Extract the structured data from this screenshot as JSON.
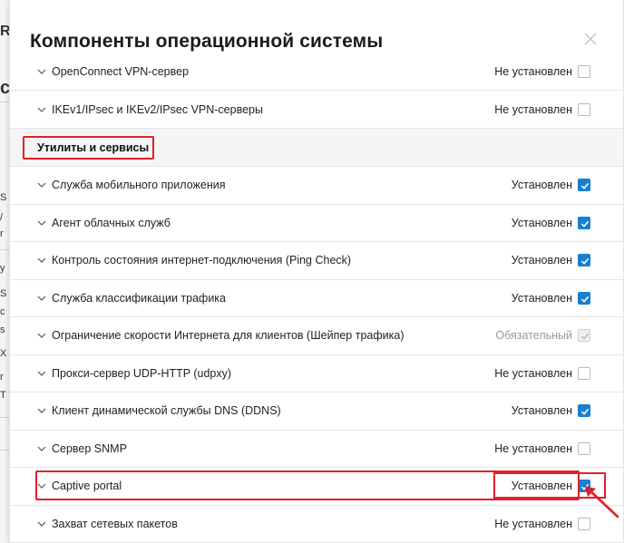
{
  "background": {
    "fragments": [
      "R",
      "c",
      "S",
      "/",
      "r",
      "y",
      "S",
      "c",
      "s",
      "X",
      "r",
      "T"
    ]
  },
  "modal": {
    "title": "Компоненты операционной системы",
    "close_icon": "close-icon"
  },
  "rows_top": [
    {
      "label": "OpenConnect VPN-сервер",
      "status": "Не установлен",
      "checked": false
    },
    {
      "label": "IKEv1/IPsec и IKEv2/IPsec VPN-серверы",
      "status": "Не установлен",
      "checked": false
    }
  ],
  "section": {
    "title": "Утилиты и сервисы"
  },
  "rows": [
    {
      "label": "Служба мобильного приложения",
      "status": "Установлен",
      "checked": true
    },
    {
      "label": "Агент облачных служб",
      "status": "Установлен",
      "checked": true
    },
    {
      "label": "Контроль состояния интернет-подключения (Ping Check)",
      "status": "Установлен",
      "checked": true
    },
    {
      "label": "Служба классификации трафика",
      "status": "Установлен",
      "checked": true
    },
    {
      "label": "Ограничение скорости Интернета для клиентов (Шейпер трафика)",
      "status": "Обязательный",
      "checked": true,
      "disabled": true
    },
    {
      "label": "Прокси-сервер UDP-HTTP (udpxy)",
      "status": "Не установлен",
      "checked": false
    },
    {
      "label": "Клиент динамической службы DNS (DDNS)",
      "status": "Установлен",
      "checked": true
    },
    {
      "label": "Сервер SNMP",
      "status": "Не установлен",
      "checked": false
    },
    {
      "label": "Captive portal",
      "status": "Установлен",
      "checked": true
    },
    {
      "label": "Захват сетевых пакетов",
      "status": "Не установлен",
      "checked": false
    }
  ],
  "colors": {
    "accent": "#1b7fd0",
    "highlight": "#e0202a"
  }
}
